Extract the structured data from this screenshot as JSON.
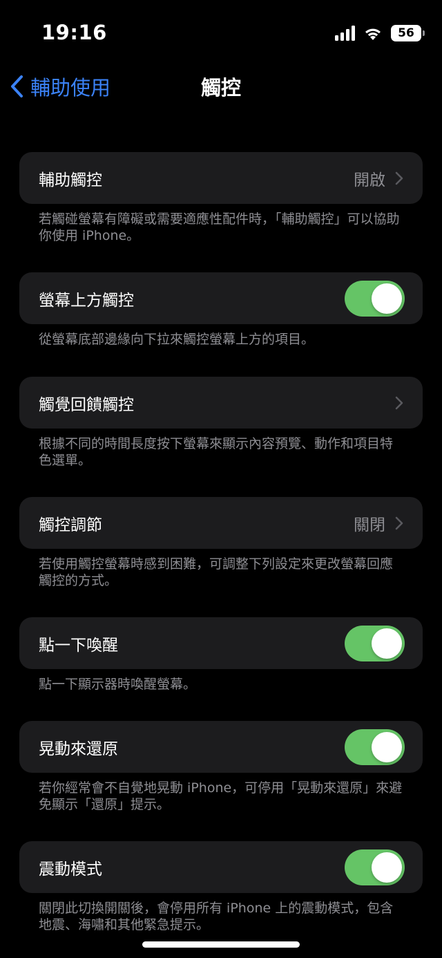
{
  "status_bar": {
    "time": "19:16",
    "battery": "56",
    "icons": [
      "cellular-signal-icon",
      "wifi-icon",
      "battery-icon"
    ]
  },
  "nav": {
    "back_label": "輔助使用",
    "title": "觸控"
  },
  "colors": {
    "background": "#000000",
    "cell": "#1c1c1e",
    "accent": "#3b82f6",
    "toggle_on": "#65c466",
    "secondary_text": "#8e8e93"
  },
  "sections": [
    {
      "label": "輔助觸控",
      "value": "開啟",
      "footer": "若觸碰螢幕有障礙或需要適應性配件時，「輔助觸控」可以協助你使用 iPhone。"
    },
    {
      "label": "螢幕上方觸控",
      "toggle": true,
      "footer": "從螢幕底部邊緣向下拉來觸控螢幕上方的項目。"
    },
    {
      "label": "觸覺回饋觸控",
      "value": "",
      "footer": "根據不同的時間長度按下螢幕來顯示內容預覽、動作和項目特色選單。"
    },
    {
      "label": "觸控調節",
      "value": "關閉",
      "footer": "若使用觸控螢幕時感到困難，可調整下列設定來更改螢幕回應觸控的方式。"
    },
    {
      "label": "點一下喚醒",
      "toggle": true,
      "footer": "點一下顯示器時喚醒螢幕。"
    },
    {
      "label": "晃動來還原",
      "toggle": true,
      "footer": "若你經常會不自覺地晃動 iPhone，可停用「晃動來還原」來避免顯示「還原」提示。"
    },
    {
      "label": "震動模式",
      "toggle": true,
      "footer": "關閉此切換開關後，會停用所有 iPhone 上的震動模式，包含地震、海嘯和其他緊急提示。"
    }
  ]
}
